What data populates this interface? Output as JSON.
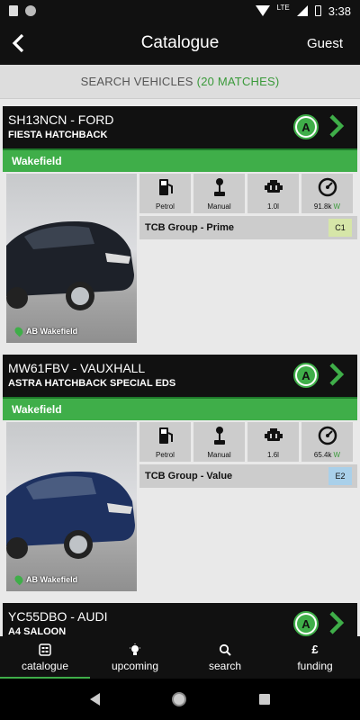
{
  "status_bar": {
    "time": "3:38",
    "network": "LTE"
  },
  "app_bar": {
    "title": "Catalogue",
    "guest_label": "Guest"
  },
  "search": {
    "label": "SEARCH VEHICLES",
    "matches": "(20 MATCHES)"
  },
  "vehicles": [
    {
      "reg_make": "SH13NCN - FORD",
      "model": "FIESTA HATCHBACK",
      "location": "Wakefield",
      "photo_caption": "AB Wakefield",
      "fuel": "Petrol",
      "transmission": "Manual",
      "engine": "1.0l",
      "mileage": "91.8k",
      "mileage_flag": "W",
      "group": "TCB Group - Prime",
      "grade": "C1",
      "grade_color": "#d6e6a8",
      "car_color": "#1d2129"
    },
    {
      "reg_make": "MW61FBV - VAUXHALL",
      "model": "ASTRA HATCHBACK SPECIAL EDS",
      "location": "Wakefield",
      "photo_caption": "AB Wakefield",
      "fuel": "Petrol",
      "transmission": "Manual",
      "engine": "1.6l",
      "mileage": "65.4k",
      "mileage_flag": "W",
      "group": "TCB Group - Value",
      "grade": "E2",
      "grade_color": "#a9d0ea",
      "car_color": "#1e3160"
    },
    {
      "reg_make": "YC55DBO - AUDI",
      "model": "A4 SALOON"
    }
  ],
  "nav": [
    {
      "label": "catalogue",
      "icon": "catalogue-icon",
      "active": true
    },
    {
      "label": "upcoming",
      "icon": "lightbulb-icon"
    },
    {
      "label": "search",
      "icon": "search-icon"
    },
    {
      "label": "funding",
      "icon": "pound-icon",
      "glyph": "£"
    }
  ],
  "colors": {
    "accent": "#3fae49",
    "header": "#111111",
    "match_text": "#3a9a3a"
  }
}
